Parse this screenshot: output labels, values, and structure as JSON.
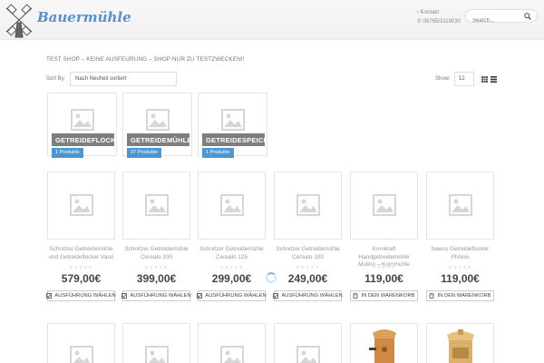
{
  "header": {
    "logo_text": "Bauermühle",
    "contact_label": "Kontakt",
    "phone": "08765/3119030",
    "search_placeholder": "Search..."
  },
  "notice": "TEST SHOP – KEINE AUSFEURUNG – SHOP NUR ZU TESTZWECKEN!!",
  "toolbar": {
    "sort_label": "Sort By:",
    "sort_value": "Nach Neuheit sortiert",
    "show_label": "Show:",
    "show_value": "12"
  },
  "categories": [
    {
      "name": "GETREIDEFLOCKER",
      "count": "1 Produkte"
    },
    {
      "name": "GETREIDEMÜHLEN",
      "count": "27 Produkte"
    },
    {
      "name": "GETREIDESPEICHER",
      "count": "1 Produkte"
    }
  ],
  "products": [
    {
      "name": "Schnitzer Getreidemühle und Getreideflocker Vario",
      "price": "579,00€",
      "button": "AUSFÜHRUNG WÄHLEN",
      "stars": "★★★★★"
    },
    {
      "name": "Schnitzer Getreidemühle Cerealo 200",
      "price": "399,00€",
      "button": "AUSFÜHRUNG WÄHLEN",
      "stars": "★★★★★"
    },
    {
      "name": "Schnitzer Getreidemühle Cerealo 125",
      "price": "299,00€",
      "button": "AUSFÜHRUNG WÄHLEN",
      "stars": "★★★★★"
    },
    {
      "name": "Schnitzer Getreidemühle Cerealo 100",
      "price": "249,00€",
      "button": "AUSFÜHRUNG WÄHLEN",
      "stars": "★★★★★"
    },
    {
      "name": "Komkraft Handgetreidemühle Mulino – Kornmühle",
      "price": "119,00€",
      "button": "IN DEN WARENKORB",
      "stars": "★★★★★"
    },
    {
      "name": "hawos Getreideflocker Phönix",
      "price": "119,00€",
      "button": "IN DEN WARENKORB",
      "stars": "★★★★★"
    }
  ],
  "icons": {
    "logo": "windmill-icon",
    "search": "search-icon",
    "placeholder": "image-placeholder-icon",
    "options": "checkbox-icon",
    "cart": "cart-icon",
    "grid": "grid-view-icon",
    "list": "list-view-icon"
  },
  "colors": {
    "accent": "#4d96d1",
    "category_bar": "#7e7e7e",
    "logo": "#5a8ec7"
  }
}
